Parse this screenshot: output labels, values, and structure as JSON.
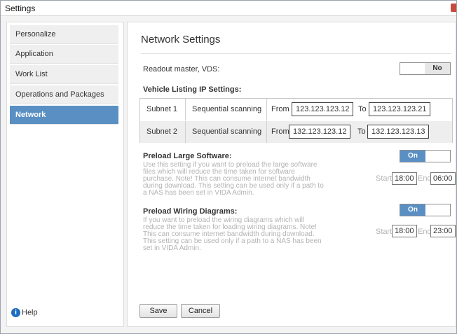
{
  "window": {
    "title": "Settings"
  },
  "sidebar": {
    "items": [
      {
        "label": "Personalize"
      },
      {
        "label": "Application"
      },
      {
        "label": "Work List"
      },
      {
        "label": "Operations and Packages"
      },
      {
        "label": "Network"
      }
    ],
    "active": "Network",
    "help_label": "Help"
  },
  "main": {
    "title": "Network Settings",
    "readout": {
      "label": "Readout master, VDS:",
      "value": "No"
    },
    "vehicle_listing": {
      "heading": "Vehicle Listing IP Settings:",
      "rows": [
        {
          "name": "Subnet 1",
          "mode": "Sequential scanning",
          "from_label": "From",
          "from": "123.123.123.12",
          "to_label": "To",
          "to": "123.123.123.21"
        },
        {
          "name": "Subnet 2",
          "mode": "Sequential scanning",
          "from_label": "From",
          "from": "132.123.123.12",
          "to_label": "To",
          "to": "132.123.123.13"
        }
      ]
    },
    "preload_software": {
      "heading": "Preload Large Software:",
      "desc": "Use this setting if you want to preload the large software files which will reduce the time taken for software purchase. Note! This can consume internet bandwidth during download. This setting can be used only if a path to a NAS has been set in VIDA Admin.",
      "value": "On",
      "start_label": "Start",
      "start": "18:00",
      "end_label": "End",
      "end": "06:00"
    },
    "preload_wiring": {
      "heading": "Preload Wiring Diagrams:",
      "desc": "If you want to preload the wiring diagrams which will reduce the time taken for loading wiring diagrams. Note! This can consume internet bandwidth during download. This setting can be used only if a path to a NAS has been set in VIDA Admin.",
      "value": "On",
      "start_label": "Start",
      "start": "18:00",
      "end_label": "End",
      "end": "23:00"
    },
    "buttons": {
      "save": "Save",
      "cancel": "Cancel"
    }
  },
  "colors": {
    "accent": "#5a8fc4",
    "help_icon": "#1e6cbf",
    "close": "#c74b3b"
  },
  "icons": {
    "help": "info-icon",
    "close": "close-icon"
  }
}
